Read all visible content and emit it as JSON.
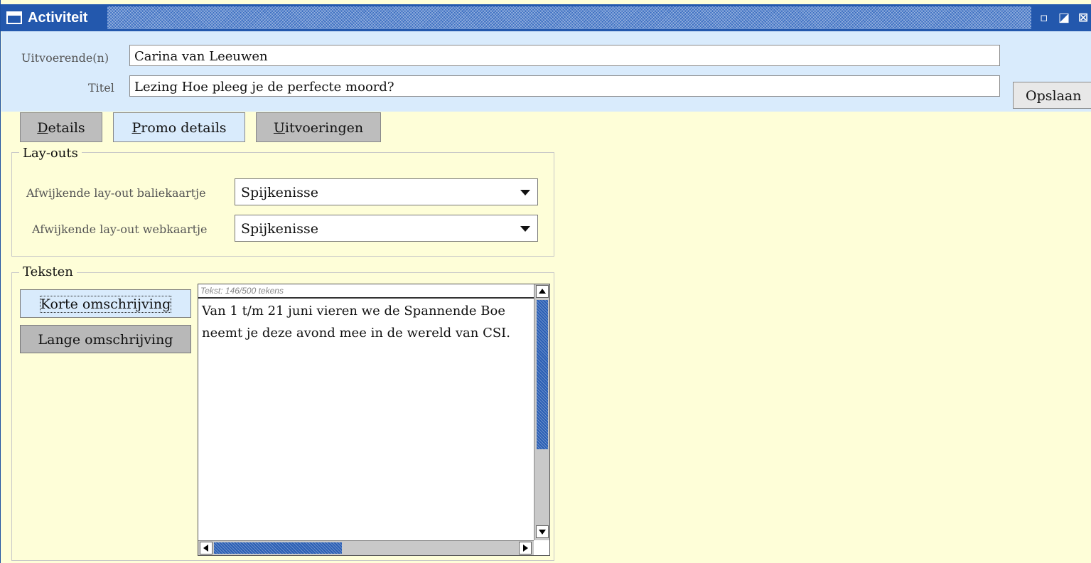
{
  "window": {
    "title": "Activiteit",
    "icons": [
      "window-icon",
      "minimize-icon",
      "maximize-icon",
      "close-icon"
    ],
    "minimize_glyph": "▫",
    "maximize_glyph": "◪",
    "close_glyph": "⊠"
  },
  "header": {
    "performers_label": "Uitvoerende(n)",
    "performers_value": "Carina van Leeuwen",
    "title_label": "Titel",
    "title_value": "Lezing Hoe pleeg je de perfecte moord?",
    "save_label": "Opslaan"
  },
  "tabs": [
    {
      "first": "D",
      "rest": "etails"
    },
    {
      "first": "P",
      "rest": "romo details"
    },
    {
      "first": "U",
      "rest": "itvoeringen"
    }
  ],
  "layouts": {
    "legend": "Lay-outs",
    "counter_label": "Afwijkende lay-out baliekaartje",
    "counter_value": "Spijkenisse",
    "web_label": "Afwijkende lay-out webkaartje",
    "web_value": "Spijkenisse"
  },
  "texts": {
    "legend": "Teksten",
    "short_label": "Korte omschrijving",
    "long_label": "Lange omschrijving",
    "counter": "Tekst: 146/500 tekens",
    "lines": [
      "Van 1 t/m 21 juni vieren we de Spannende Boe",
      "neemt je deze avond mee in de wereld van CSI."
    ]
  },
  "colors": {
    "titlebar": "#2358ad",
    "header_bg": "#d9ebfc",
    "body_bg": "#fefed8",
    "tab_gray": "#bdbdbd"
  }
}
